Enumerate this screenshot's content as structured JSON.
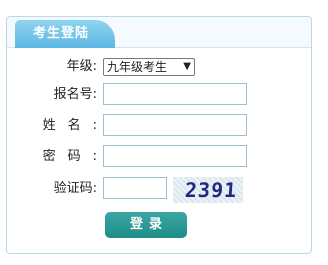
{
  "panel": {
    "title": "考生登陆"
  },
  "form": {
    "grade_label": "年级:",
    "grade_value": "九年级考生",
    "exam_no_label": "报名号:",
    "name_label": "姓名:",
    "password_label": "密码:",
    "captcha_label": "验证码:",
    "captcha_text": "2391",
    "login_button": "登录"
  }
}
